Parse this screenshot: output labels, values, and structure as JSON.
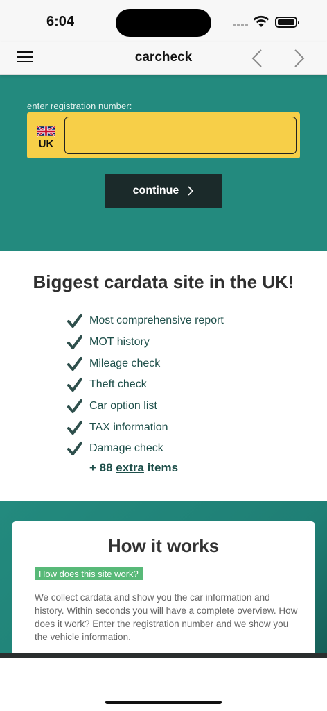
{
  "status_bar": {
    "time": "6:04"
  },
  "nav": {
    "title": "carcheck"
  },
  "search": {
    "label": "enter registration number:",
    "country": "UK",
    "input_value": "",
    "continue_label": "continue"
  },
  "features": {
    "title": "Biggest cardata site in the UK!",
    "items": [
      "Most comprehensive report",
      "MOT history",
      "Mileage check",
      "Theft check",
      "Car option list",
      "TAX information",
      "Damage check"
    ],
    "extra_prefix": "+ 88",
    "extra_link": "extra",
    "extra_suffix": "items"
  },
  "how_it_works": {
    "title": "How it works",
    "badge": "How does this site work?",
    "text": "We collect cardata and show you the car information and history. Within seconds you will have a complete overview. How does it work? Enter the registration number and we show you the vehicle information."
  },
  "colors": {
    "teal": "#238a7e",
    "plate_yellow": "#f7cf48",
    "button_dark": "#1b2a2a",
    "badge_green": "#58b978",
    "check_dark": "#1e4f4a"
  }
}
